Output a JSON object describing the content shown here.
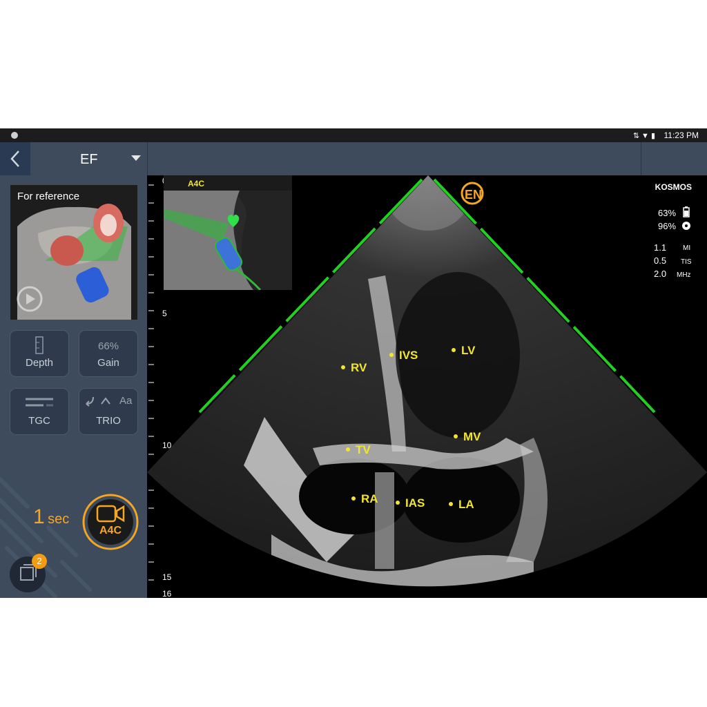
{
  "status_bar": {
    "time": "11:23 PM"
  },
  "header": {
    "title": "EF",
    "back_icon": "chevron-left-icon",
    "dropdown_icon": "caret-down-icon"
  },
  "sidebar": {
    "reference": {
      "title": "For reference",
      "play_icon": "play-icon"
    },
    "controls": {
      "depth": {
        "label": "Depth",
        "icon": "ruler-icon"
      },
      "gain": {
        "value": "66%",
        "label": "Gain"
      },
      "tgc": {
        "label": "TGC",
        "icon": "sliders-icon"
      },
      "trio": {
        "label": "TRIO",
        "glyph": "Aa",
        "icon": "undo-icon"
      }
    },
    "capture": {
      "seconds_value": "1",
      "seconds_unit": "sec",
      "record_label": "A4C",
      "record_icon": "video-camera-icon"
    },
    "clips": {
      "count": "2",
      "icon": "clips-stack-icon"
    }
  },
  "image": {
    "view_label": "A4C",
    "depth_ticks": [
      "0",
      "5",
      "10",
      "15",
      "16"
    ],
    "device_name": "KOSMOS",
    "battery": "63%",
    "storage": "96%",
    "acoustic": [
      {
        "value": "1.1",
        "unit": "MI"
      },
      {
        "value": "0.5",
        "unit": "TIS"
      },
      {
        "value": "2.0",
        "unit": "MHz"
      }
    ],
    "labels": {
      "rv": "RV",
      "ivs": "IVS",
      "lv": "LV",
      "tv": "TV",
      "mv": "MV",
      "ra": "RA",
      "ias": "IAS",
      "la": "LA"
    },
    "orientation_marker": "EN",
    "accent_color": "#f5a623",
    "guide_color": "#22d022",
    "label_color": "#f3e52a"
  }
}
